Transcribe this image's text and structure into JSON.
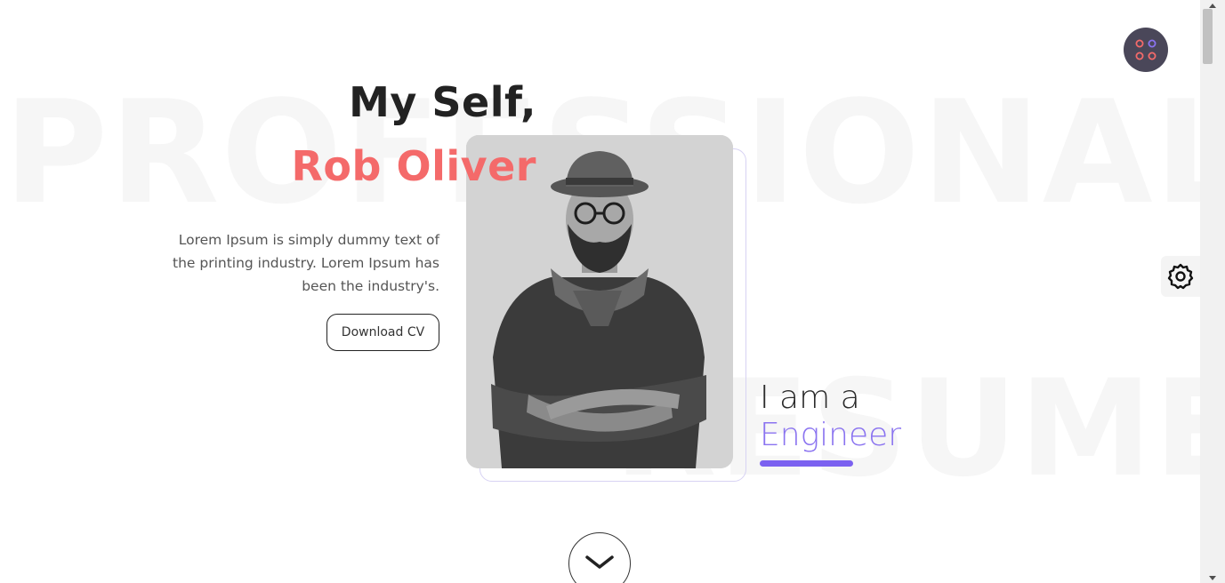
{
  "background_words": {
    "top": "PROFESSIONAL",
    "bottom": "RESUME"
  },
  "hero": {
    "greeting": "My Self,",
    "name": "Rob Oliver",
    "intro": "Lorem Ipsum is simply dummy text of the printing industry. Lorem Ipsum has been the industry's.",
    "cta_label": "Download CV",
    "role_prefix": "I am a",
    "role_title": "Engineer"
  },
  "icons": {
    "menu": "grid-dots-icon",
    "settings": "gear-icon",
    "scroll": "chevron-down-icon"
  },
  "colors": {
    "name_accent": "#f46a6a",
    "role_accent": "#8a73f0",
    "role_bar": "#7b61f0",
    "menu_bg": "#4a4759"
  }
}
